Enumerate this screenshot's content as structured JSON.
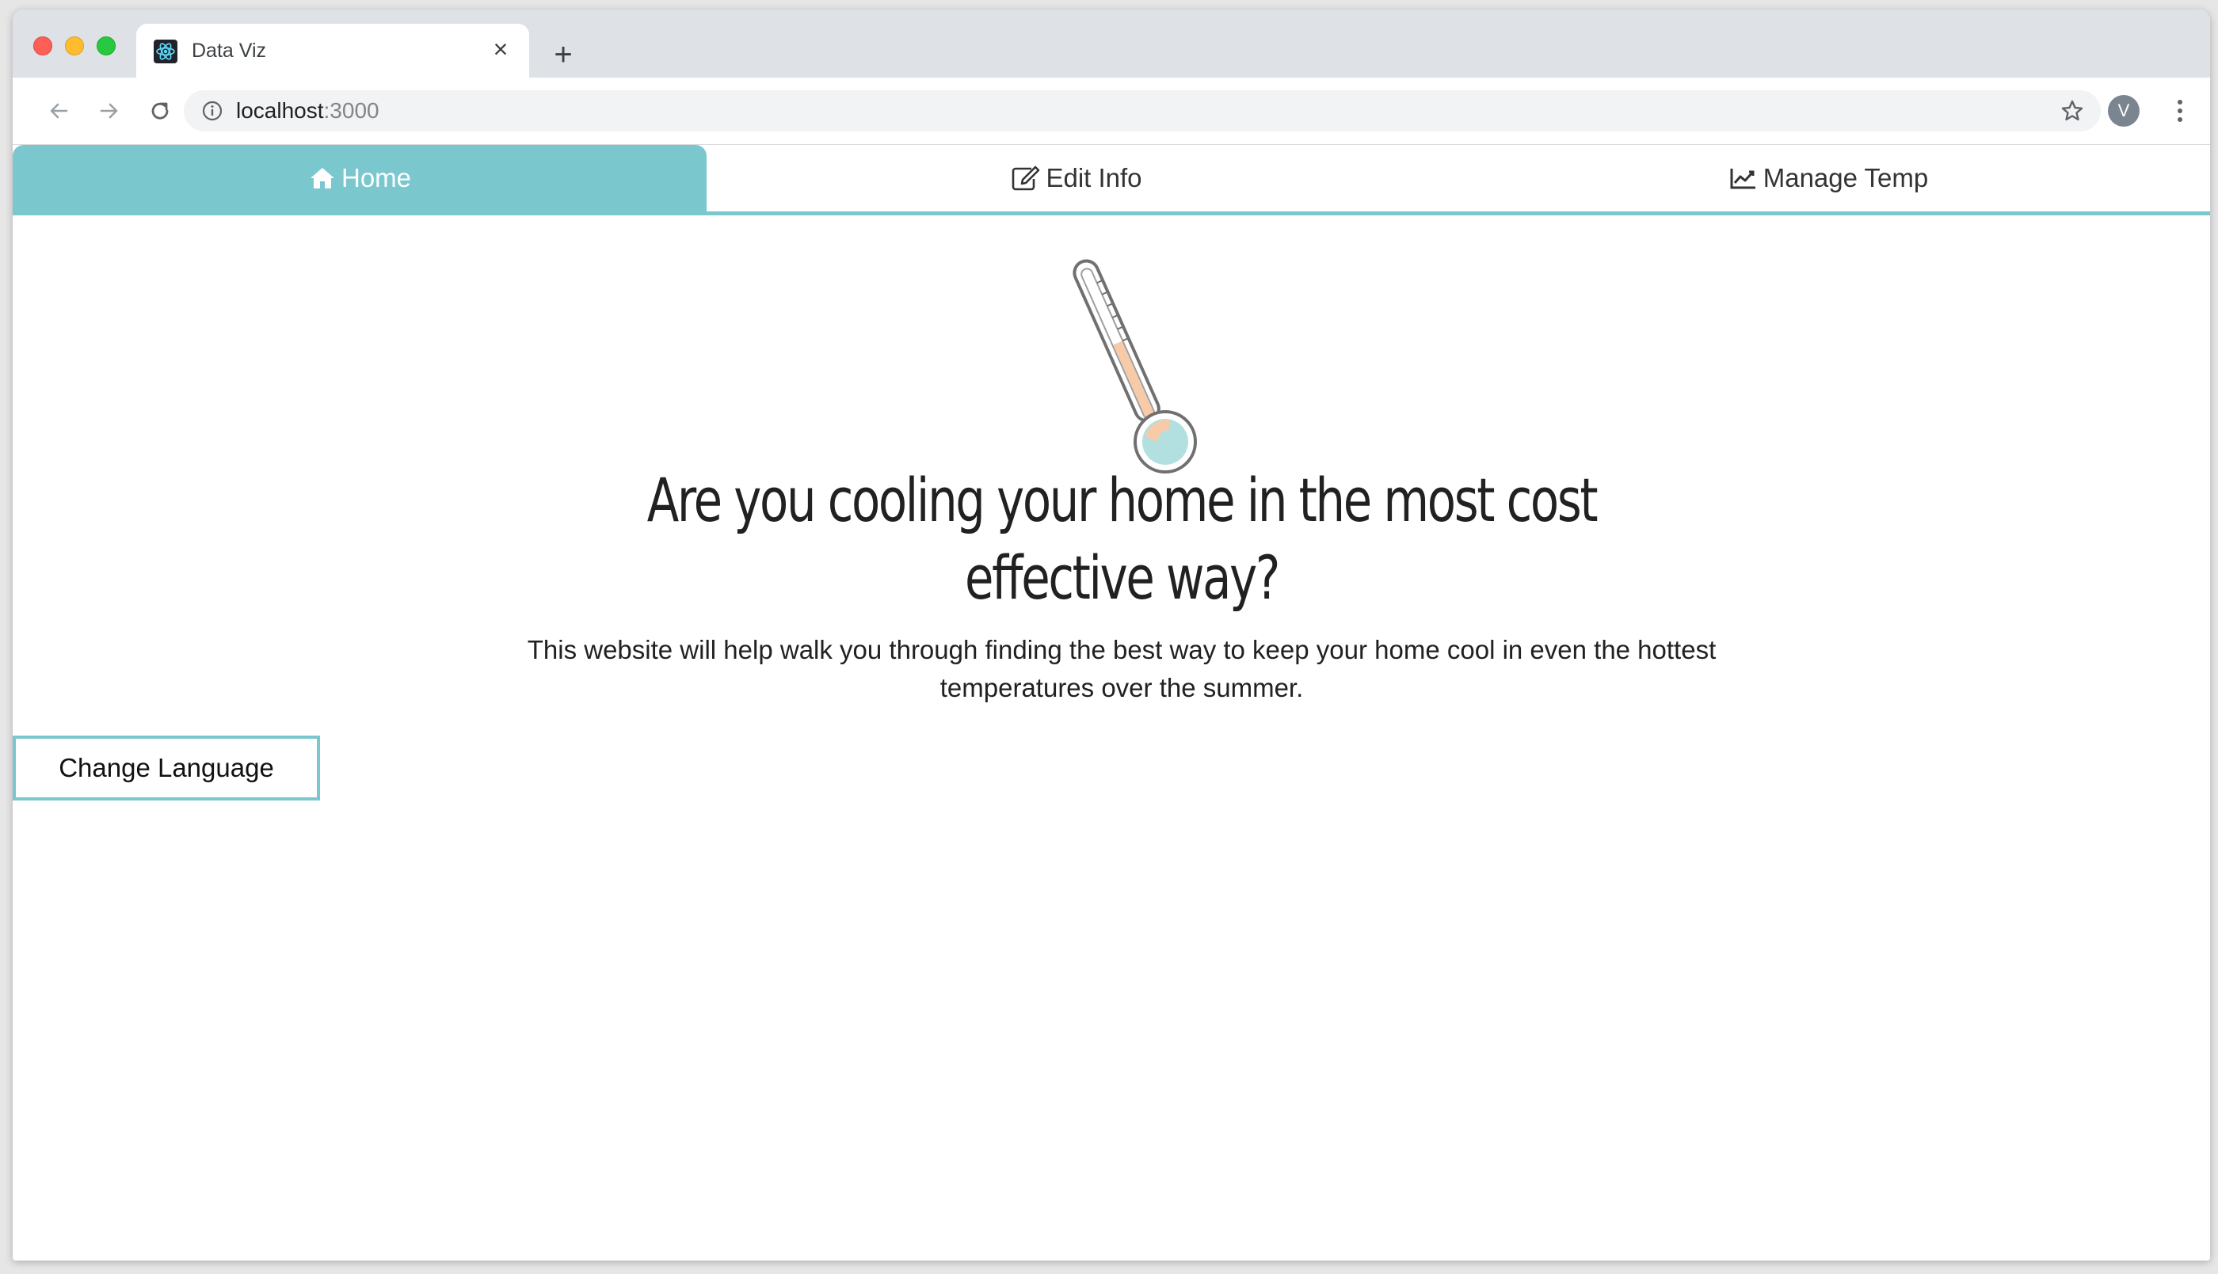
{
  "browser": {
    "tab_title": "Data Viz",
    "tab_favicon": "react-icon",
    "url_host": "localhost",
    "url_port": ":3000",
    "profile_initial": "V"
  },
  "nav": {
    "tabs": [
      {
        "label": "Home",
        "icon": "home-icon",
        "active": true
      },
      {
        "label": "Edit Info",
        "icon": "edit-icon",
        "active": false
      },
      {
        "label": "Manage Temp",
        "icon": "chart-line-icon",
        "active": false
      }
    ]
  },
  "hero": {
    "headline": "Are you cooling your home in the most cost effective way?",
    "subtext": "This website will help walk you through finding the best way to keep your home cool in even the hottest temperatures over the summer."
  },
  "actions": {
    "change_language": "Change Language"
  },
  "colors": {
    "accent": "#7ac7ce",
    "thermo_warm": "#f8cba8",
    "thermo_cool": "#b2e0e0"
  }
}
